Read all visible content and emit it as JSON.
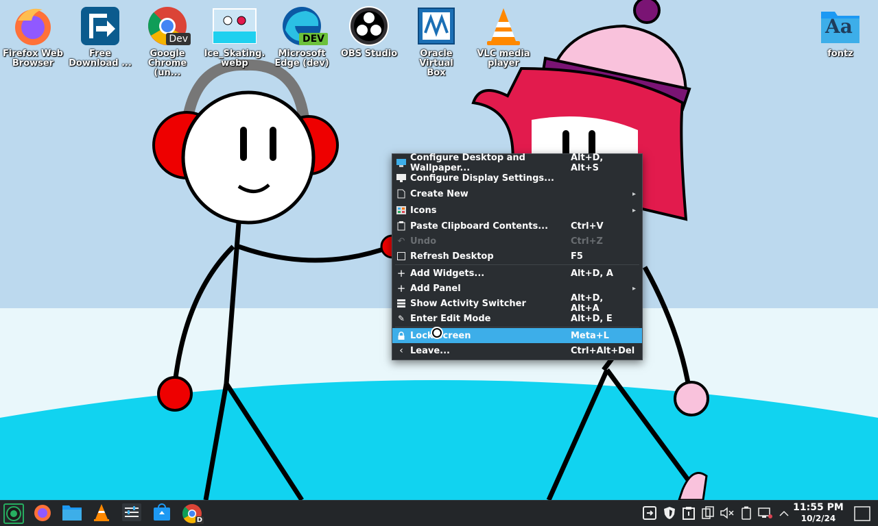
{
  "desktop": {
    "icons": [
      {
        "label": "Firefox Web\nBrowser",
        "icon": "firefox-icon"
      },
      {
        "label": "Free\nDownload ...",
        "icon": "free-download-manager-icon"
      },
      {
        "label": "Google\nChrome (un...",
        "icon": "chrome-dev-icon",
        "badge": "Dev"
      },
      {
        "label": "Ice_Skating.\nwebp",
        "icon": "image-file-icon"
      },
      {
        "label": "Microsoft\nEdge (dev)",
        "icon": "edge-dev-icon",
        "badge": "DEV"
      },
      {
        "label": "OBS Studio",
        "icon": "obs-icon"
      },
      {
        "label": "Oracle Virtual\nBox",
        "icon": "virtualbox-icon"
      },
      {
        "label": "VLC media\nplayer",
        "icon": "vlc-icon"
      },
      {
        "label": "fontz",
        "icon": "folder-fonts-icon",
        "glyph": "Aa"
      }
    ]
  },
  "context_menu": {
    "items": [
      {
        "label": "Configure Desktop and Wallpaper...",
        "shortcut": "Alt+D, Alt+S",
        "icon": "configure-desktop-icon",
        "submenu": false,
        "disabled": false
      },
      {
        "label": "Configure Display Settings...",
        "shortcut": "",
        "icon": "display-icon",
        "submenu": false,
        "disabled": false
      },
      {
        "label": "Create New",
        "shortcut": "",
        "icon": "new-file-icon",
        "submenu": true,
        "disabled": false
      },
      {
        "label": "Icons",
        "shortcut": "",
        "icon": "icons-view-icon",
        "submenu": true,
        "disabled": false
      },
      {
        "label": "Paste Clipboard Contents...",
        "shortcut": "Ctrl+V",
        "icon": "paste-icon",
        "submenu": false,
        "disabled": false
      },
      {
        "label": "Undo",
        "shortcut": "Ctrl+Z",
        "icon": "undo-icon",
        "submenu": false,
        "disabled": true
      },
      {
        "label": "Refresh Desktop",
        "shortcut": "F5",
        "icon": "refresh-icon",
        "submenu": false,
        "disabled": false
      },
      {
        "label": "Add Widgets...",
        "shortcut": "Alt+D, A",
        "icon": "add-icon",
        "submenu": false,
        "disabled": false
      },
      {
        "label": "Add Panel",
        "shortcut": "",
        "icon": "add-icon",
        "submenu": true,
        "disabled": false
      },
      {
        "label": "Show Activity Switcher",
        "shortcut": "Alt+D, Alt+A",
        "icon": "activities-icon",
        "submenu": false,
        "disabled": false
      },
      {
        "label": "Enter Edit Mode",
        "shortcut": "Alt+D, E",
        "icon": "edit-icon",
        "submenu": false,
        "disabled": false
      },
      {
        "label": "Lock Screen",
        "shortcut": "Meta+L",
        "icon": "lock-icon",
        "submenu": false,
        "disabled": false,
        "selected": true
      },
      {
        "label": "Leave...",
        "shortcut": "Ctrl+Alt+Del",
        "icon": "leave-icon",
        "submenu": false,
        "disabled": false
      }
    ]
  },
  "taskbar": {
    "launchers": [
      "app-launcher-icon",
      "firefox-icon",
      "file-manager-icon",
      "vlc-icon",
      "system-settings-icon",
      "discover-store-icon",
      "chrome-dev-icon"
    ],
    "chrome_badge": "D",
    "tray": [
      "free-download-manager-tray-icon",
      "shield-tray-icon",
      "clipboard-tray-icon",
      "clipboard-history-icon",
      "volume-muted-icon",
      "battery-icon",
      "network-icon",
      "expand-tray-icon"
    ],
    "clock": {
      "time": "11:55 PM",
      "date": "10/2/24"
    }
  },
  "colors": {
    "menu_bg": "#2a2e32",
    "menu_selected": "#3daee9",
    "taskbar_bg": "#232629",
    "sky": "#bcd9ee",
    "ice": "#0ed2ef"
  }
}
